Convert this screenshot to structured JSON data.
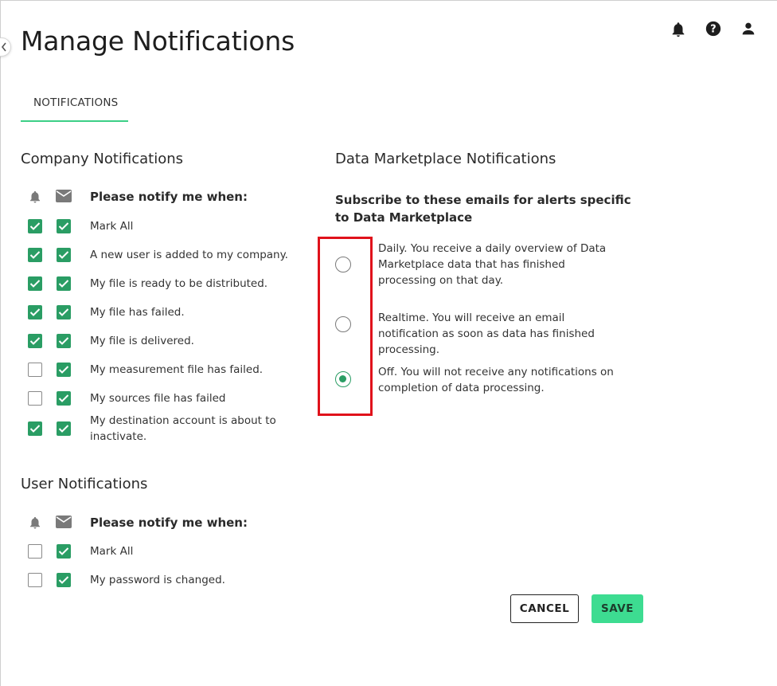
{
  "header": {
    "title": "Manage Notifications",
    "icons": [
      "bell-icon",
      "help-icon",
      "user-icon"
    ]
  },
  "tabs": [
    {
      "label": "NOTIFICATIONS",
      "selected": true
    }
  ],
  "company": {
    "title": "Company Notifications",
    "notify_header": "Please notify me when:",
    "items": [
      {
        "label": "Mark All",
        "bell": true,
        "email": true
      },
      {
        "label": "A new user is added to my company.",
        "bell": true,
        "email": true
      },
      {
        "label": "My file is ready to be distributed.",
        "bell": true,
        "email": true
      },
      {
        "label": "My file has failed.",
        "bell": true,
        "email": true
      },
      {
        "label": "My file is delivered.",
        "bell": true,
        "email": true
      },
      {
        "label": "My measurement file has failed.",
        "bell": false,
        "email": true
      },
      {
        "label": "My sources file has failed",
        "bell": false,
        "email": true
      },
      {
        "label": "My destination account is about to inactivate.",
        "bell": true,
        "email": true
      }
    ]
  },
  "user": {
    "title": "User Notifications",
    "notify_header": "Please notify me when:",
    "items": [
      {
        "label": "Mark All",
        "bell": false,
        "email": true
      },
      {
        "label": "My password is changed.",
        "bell": false,
        "email": true
      }
    ]
  },
  "marketplace": {
    "title": "Data Marketplace Notifications",
    "subtitle": "Subscribe to these emails for alerts specific to Data Marketplace",
    "options": [
      {
        "label": "Daily. You receive a daily overview of Data Marketplace data that has finished processing on that day.",
        "selected": false
      },
      {
        "label": "Realtime. You will receive an email notification as soon as data has finished processing.",
        "selected": false
      },
      {
        "label": "Off. You will not receive any notifications on completion of data processing.",
        "selected": true
      }
    ]
  },
  "actions": {
    "cancel_label": "CANCEL",
    "save_label": "SAVE"
  },
  "colors": {
    "accent": "#3ddc91",
    "checkbox": "#2a9d64",
    "highlight": "#e0121b"
  }
}
